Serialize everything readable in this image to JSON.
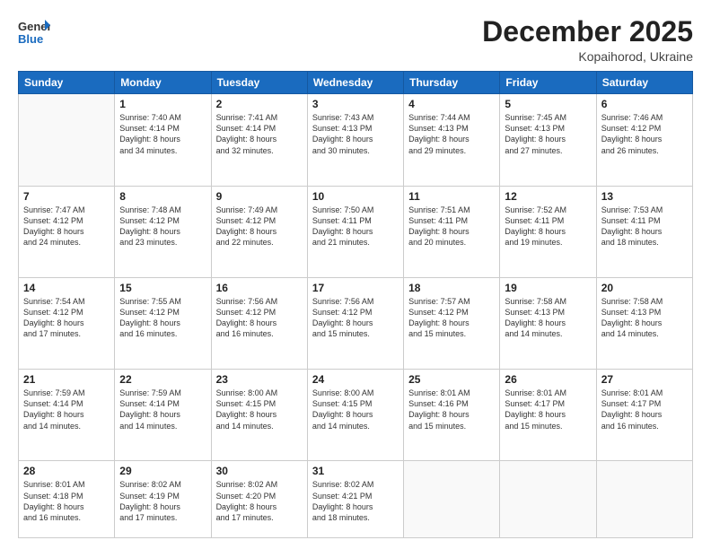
{
  "header": {
    "logo": {
      "line1": "General",
      "line2": "Blue"
    },
    "title": "December 2025",
    "subtitle": "Kopaihorod, Ukraine"
  },
  "days_of_week": [
    "Sunday",
    "Monday",
    "Tuesday",
    "Wednesday",
    "Thursday",
    "Friday",
    "Saturday"
  ],
  "weeks": [
    [
      {
        "day": "",
        "info": ""
      },
      {
        "day": "1",
        "info": "Sunrise: 7:40 AM\nSunset: 4:14 PM\nDaylight: 8 hours\nand 34 minutes."
      },
      {
        "day": "2",
        "info": "Sunrise: 7:41 AM\nSunset: 4:14 PM\nDaylight: 8 hours\nand 32 minutes."
      },
      {
        "day": "3",
        "info": "Sunrise: 7:43 AM\nSunset: 4:13 PM\nDaylight: 8 hours\nand 30 minutes."
      },
      {
        "day": "4",
        "info": "Sunrise: 7:44 AM\nSunset: 4:13 PM\nDaylight: 8 hours\nand 29 minutes."
      },
      {
        "day": "5",
        "info": "Sunrise: 7:45 AM\nSunset: 4:13 PM\nDaylight: 8 hours\nand 27 minutes."
      },
      {
        "day": "6",
        "info": "Sunrise: 7:46 AM\nSunset: 4:12 PM\nDaylight: 8 hours\nand 26 minutes."
      }
    ],
    [
      {
        "day": "7",
        "info": "Sunrise: 7:47 AM\nSunset: 4:12 PM\nDaylight: 8 hours\nand 24 minutes."
      },
      {
        "day": "8",
        "info": "Sunrise: 7:48 AM\nSunset: 4:12 PM\nDaylight: 8 hours\nand 23 minutes."
      },
      {
        "day": "9",
        "info": "Sunrise: 7:49 AM\nSunset: 4:12 PM\nDaylight: 8 hours\nand 22 minutes."
      },
      {
        "day": "10",
        "info": "Sunrise: 7:50 AM\nSunset: 4:11 PM\nDaylight: 8 hours\nand 21 minutes."
      },
      {
        "day": "11",
        "info": "Sunrise: 7:51 AM\nSunset: 4:11 PM\nDaylight: 8 hours\nand 20 minutes."
      },
      {
        "day": "12",
        "info": "Sunrise: 7:52 AM\nSunset: 4:11 PM\nDaylight: 8 hours\nand 19 minutes."
      },
      {
        "day": "13",
        "info": "Sunrise: 7:53 AM\nSunset: 4:11 PM\nDaylight: 8 hours\nand 18 minutes."
      }
    ],
    [
      {
        "day": "14",
        "info": "Sunrise: 7:54 AM\nSunset: 4:12 PM\nDaylight: 8 hours\nand 17 minutes."
      },
      {
        "day": "15",
        "info": "Sunrise: 7:55 AM\nSunset: 4:12 PM\nDaylight: 8 hours\nand 16 minutes."
      },
      {
        "day": "16",
        "info": "Sunrise: 7:56 AM\nSunset: 4:12 PM\nDaylight: 8 hours\nand 16 minutes."
      },
      {
        "day": "17",
        "info": "Sunrise: 7:56 AM\nSunset: 4:12 PM\nDaylight: 8 hours\nand 15 minutes."
      },
      {
        "day": "18",
        "info": "Sunrise: 7:57 AM\nSunset: 4:12 PM\nDaylight: 8 hours\nand 15 minutes."
      },
      {
        "day": "19",
        "info": "Sunrise: 7:58 AM\nSunset: 4:13 PM\nDaylight: 8 hours\nand 14 minutes."
      },
      {
        "day": "20",
        "info": "Sunrise: 7:58 AM\nSunset: 4:13 PM\nDaylight: 8 hours\nand 14 minutes."
      }
    ],
    [
      {
        "day": "21",
        "info": "Sunrise: 7:59 AM\nSunset: 4:14 PM\nDaylight: 8 hours\nand 14 minutes."
      },
      {
        "day": "22",
        "info": "Sunrise: 7:59 AM\nSunset: 4:14 PM\nDaylight: 8 hours\nand 14 minutes."
      },
      {
        "day": "23",
        "info": "Sunrise: 8:00 AM\nSunset: 4:15 PM\nDaylight: 8 hours\nand 14 minutes."
      },
      {
        "day": "24",
        "info": "Sunrise: 8:00 AM\nSunset: 4:15 PM\nDaylight: 8 hours\nand 14 minutes."
      },
      {
        "day": "25",
        "info": "Sunrise: 8:01 AM\nSunset: 4:16 PM\nDaylight: 8 hours\nand 15 minutes."
      },
      {
        "day": "26",
        "info": "Sunrise: 8:01 AM\nSunset: 4:17 PM\nDaylight: 8 hours\nand 15 minutes."
      },
      {
        "day": "27",
        "info": "Sunrise: 8:01 AM\nSunset: 4:17 PM\nDaylight: 8 hours\nand 16 minutes."
      }
    ],
    [
      {
        "day": "28",
        "info": "Sunrise: 8:01 AM\nSunset: 4:18 PM\nDaylight: 8 hours\nand 16 minutes."
      },
      {
        "day": "29",
        "info": "Sunrise: 8:02 AM\nSunset: 4:19 PM\nDaylight: 8 hours\nand 17 minutes."
      },
      {
        "day": "30",
        "info": "Sunrise: 8:02 AM\nSunset: 4:20 PM\nDaylight: 8 hours\nand 17 minutes."
      },
      {
        "day": "31",
        "info": "Sunrise: 8:02 AM\nSunset: 4:21 PM\nDaylight: 8 hours\nand 18 minutes."
      },
      {
        "day": "",
        "info": ""
      },
      {
        "day": "",
        "info": ""
      },
      {
        "day": "",
        "info": ""
      }
    ]
  ]
}
